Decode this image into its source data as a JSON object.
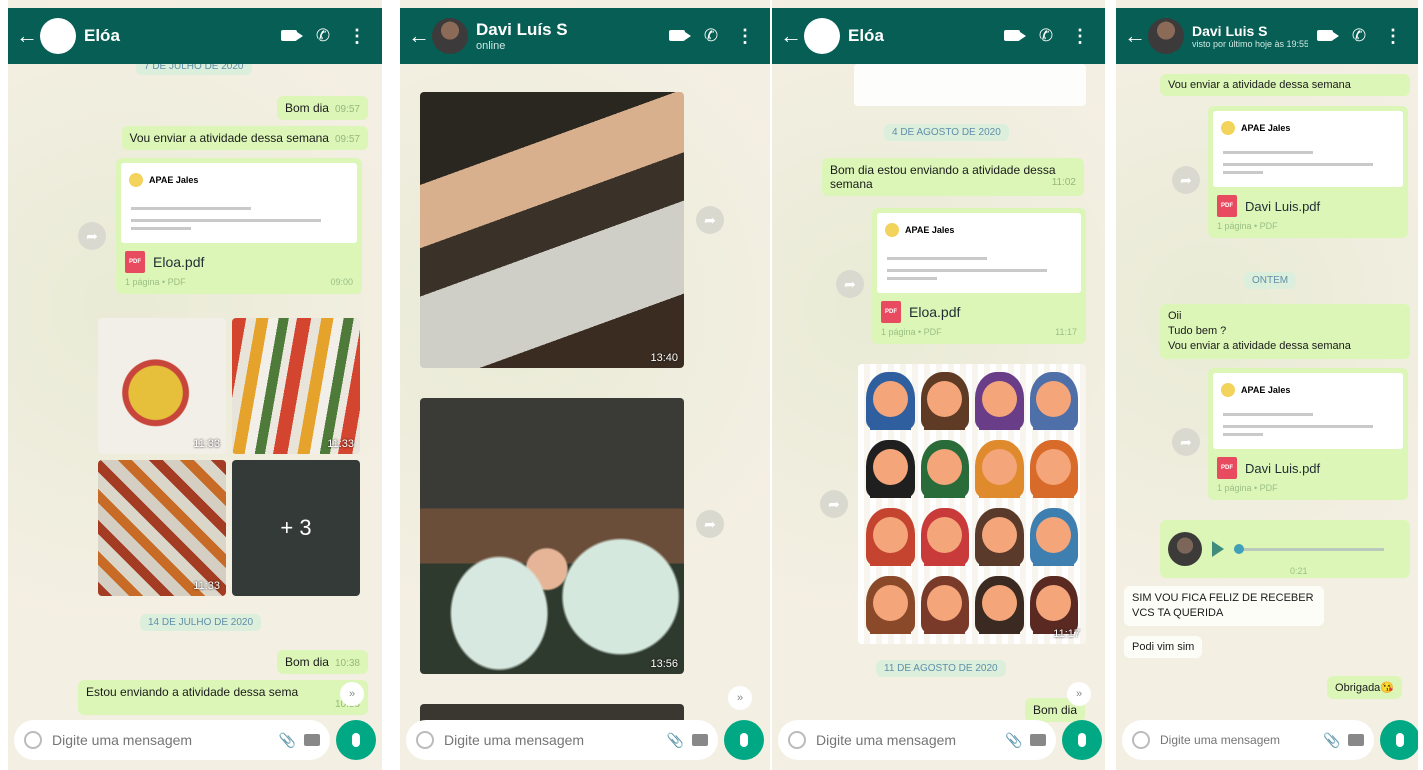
{
  "common": {
    "composer_placeholder": "Digite uma mensagem",
    "pdf_badge": "PDF",
    "doc_org": "APAE Jales"
  },
  "panel1": {
    "contact_name": "Elóa",
    "top_date": "7 DE JULHO DE 2020",
    "messages": [
      {
        "text": "Bom dia",
        "time": "09:57"
      },
      {
        "text": "Vou enviar a atividade dessa semana",
        "time": "09:57"
      }
    ],
    "document": {
      "name": "Eloa.pdf",
      "info": "1 página • PDF",
      "time": "09:00"
    },
    "media_times": [
      "11:33",
      "11:33",
      "11:33"
    ],
    "more_count": "+ 3",
    "date2": "14 DE JULHO DE 2020",
    "messages2": [
      {
        "text": "Bom dia",
        "time": "10:38"
      },
      {
        "text": "Estou enviando a atividade dessa sema",
        "time": "10:38"
      }
    ]
  },
  "panel2": {
    "contact_name": "Davi Luís S",
    "status": "online",
    "media_times": [
      "13:40",
      "13:56"
    ]
  },
  "panel3": {
    "contact_name": "Elóa",
    "date1": "4 DE AGOSTO DE 2020",
    "message": {
      "text": "Bom dia estou enviando a atividade dessa semana",
      "time": "11:02"
    },
    "document": {
      "name": "Eloa.pdf",
      "info": "1 página • PDF",
      "time": "11:17"
    },
    "image_time": "11:17",
    "date2": "11 DE AGOSTO DE 2020",
    "last_message": {
      "text": "Bom dia",
      "time": ""
    }
  },
  "panel4": {
    "contact_name": "Davi Luis S",
    "status": "visto por último hoje às 19:55",
    "messages_top": [
      {
        "text": "Vou enviar a atividade dessa semana",
        "time": ""
      }
    ],
    "document1": {
      "name": "Davi Luis.pdf",
      "info": "1 página • PDF",
      "time": ""
    },
    "date_label": "ONTEM",
    "incoming": {
      "line1": "Oii",
      "line2": "Tudo bem ?",
      "line3": "Vou enviar a atividade dessa semana"
    },
    "document2": {
      "name": "Davi Luis.pdf",
      "info": "1 página • PDF",
      "time": ""
    },
    "audio": {
      "duration": "0:21"
    },
    "reply1": "SIM VOU FICA FELIZ DE RECEBER VCS TA QUERIDA",
    "reply2": "Podi vim sim",
    "last_message": "Obrigada😘"
  },
  "colors": {
    "header": "#075e54",
    "outgoing_bubble": "#dcf6b8",
    "incoming_bubble": "#fdfdf8",
    "mic_button": "#00a884"
  }
}
